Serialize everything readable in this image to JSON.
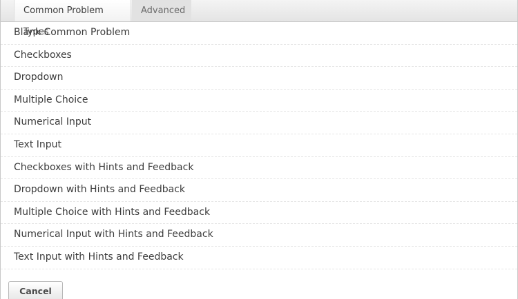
{
  "tabs": [
    {
      "label": "Common Problem Types",
      "active": true
    },
    {
      "label": "Advanced",
      "active": false
    }
  ],
  "problem_types": [
    "Blank Common Problem",
    "Checkboxes",
    "Dropdown",
    "Multiple Choice",
    "Numerical Input",
    "Text Input",
    "Checkboxes with Hints and Feedback",
    "Dropdown with Hints and Feedback",
    "Multiple Choice with Hints and Feedback",
    "Numerical Input with Hints and Feedback",
    "Text Input with Hints and Feedback"
  ],
  "actions": {
    "cancel_label": "Cancel"
  },
  "colors": {
    "text": "#3c3c3c",
    "tab_inactive_text": "#6b6b6b",
    "border": "#c8c8c8"
  }
}
